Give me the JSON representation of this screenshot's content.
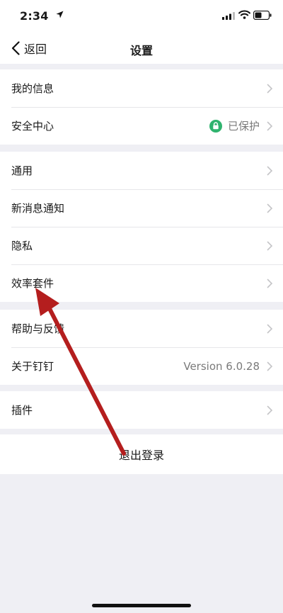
{
  "status_bar": {
    "time": "2:34"
  },
  "nav": {
    "back_label": "返回",
    "title": "设置"
  },
  "groups": [
    {
      "items": [
        {
          "label": "我的信息"
        },
        {
          "label": "安全中心",
          "value": "已保护"
        }
      ]
    },
    {
      "items": [
        {
          "label": "通用"
        },
        {
          "label": "新消息通知"
        },
        {
          "label": "隐私"
        },
        {
          "label": "效率套件"
        }
      ]
    },
    {
      "items": [
        {
          "label": "帮助与反馈"
        },
        {
          "label": "关于钉钉",
          "value": "Version 6.0.28"
        }
      ]
    },
    {
      "items": [
        {
          "label": "插件"
        }
      ]
    }
  ],
  "logout_label": "退出登录",
  "colors": {
    "background": "#efeff4",
    "security_badge": "#2fb36e",
    "annotation_arrow": "#b41e1e"
  },
  "icons": [
    "location-arrow-icon",
    "signal-icon",
    "wifi-icon",
    "battery-icon",
    "back-chevron-icon",
    "chevron-right-icon",
    "lock-icon"
  ]
}
